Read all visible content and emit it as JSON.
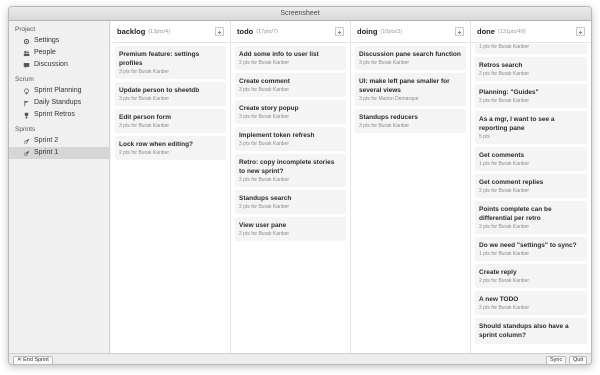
{
  "window": {
    "title": "Screensheet"
  },
  "sidebar": {
    "project_title": "Project",
    "project_items": [
      {
        "label": "Settings",
        "icon": "gear-icon"
      },
      {
        "label": "People",
        "icon": "people-icon"
      },
      {
        "label": "Discussion",
        "icon": "chat-icon"
      }
    ],
    "scrum_title": "Scrum",
    "scrum_items": [
      {
        "label": "Sprint Planning",
        "icon": "lightbulb-icon"
      },
      {
        "label": "Daily Standups",
        "icon": "flag-icon"
      },
      {
        "label": "Sprint Retros",
        "icon": "trophy-icon"
      }
    ],
    "sprints_title": "Sprints",
    "sprints_items": [
      {
        "label": "Sprint 2",
        "icon": "rocket-icon"
      },
      {
        "label": "Sprint 1",
        "icon": "rocket-icon",
        "selected": true
      }
    ]
  },
  "board": {
    "columns": [
      {
        "name": "backlog",
        "meta": "(13pts/4)",
        "cards": [
          {
            "title": "Premium feature: settings profiles",
            "meta": "3 pts for Burak Kanber"
          },
          {
            "title": "Update person to sheetdb",
            "meta": "3 pts for Burak Kanber"
          },
          {
            "title": "Edit person form",
            "meta": "3 pts for Burak Kanber"
          },
          {
            "title": "Lock row when editing?",
            "meta": "2 pts for Burak Kanber"
          }
        ]
      },
      {
        "name": "todo",
        "meta": "(17pts/7)",
        "cards": [
          {
            "title": "Add some info to user list",
            "meta": "2 pts for Burak Kanber"
          },
          {
            "title": "Create comment",
            "meta": "3 pts for Burak Kanber"
          },
          {
            "title": "Create story popup",
            "meta": "3 pts for Burak Kanber"
          },
          {
            "title": "Implement token refresh",
            "meta": "3 pts for Burak Kanber"
          },
          {
            "title": "Retro: copy incomplete stories to new sprint?",
            "meta": "2 pts for Burak Kanber"
          },
          {
            "title": "Standups search",
            "meta": "2 pts for Burak Kanber"
          },
          {
            "title": "View user pane",
            "meta": "2 pts for Burak Kanber"
          }
        ]
      },
      {
        "name": "doing",
        "meta": "(10pts/3)",
        "cards": [
          {
            "title": "Discussion pane search function",
            "meta": "3 pts for Burak Kanber"
          },
          {
            "title": "UI: make left pane smaller for several views",
            "meta": "3 pts for Marion Demarque"
          },
          {
            "title": "Standups reducers",
            "meta": "3 pts for Burak Kanber"
          }
        ]
      },
      {
        "name": "done",
        "meta": "(131pts/49)",
        "cards": [
          {
            "title": "",
            "meta": "1 pts for Burak Kanber"
          },
          {
            "title": "Retros search",
            "meta": "2 pts for Burak Kanber"
          },
          {
            "title": "Planning: \"Guides\"",
            "meta": "2 pts for Burak Kanber"
          },
          {
            "title": "As a mgr, I want to see a reporting pane",
            "meta": "5 pts"
          },
          {
            "title": "Get comments",
            "meta": "1 pts for Burak Kanber"
          },
          {
            "title": "Get comment replies",
            "meta": "2 pts for Burak Kanber"
          },
          {
            "title": "Points complete can be differential per retro",
            "meta": "2 pts for Burak Kanber"
          },
          {
            "title": "Do we need \"settings\" to sync?",
            "meta": "1 pts for Burak Kanber"
          },
          {
            "title": "Create reply",
            "meta": "2 pts for Burak Kanber"
          },
          {
            "title": "A new TODO",
            "meta": "2 pts for Burak Kanber"
          },
          {
            "title": "Should standups also have a sprint column?",
            "meta": ""
          }
        ]
      }
    ]
  },
  "footer": {
    "end_sprint": "✕ End Sprint",
    "sync": "Sync",
    "quit": "Quit"
  }
}
